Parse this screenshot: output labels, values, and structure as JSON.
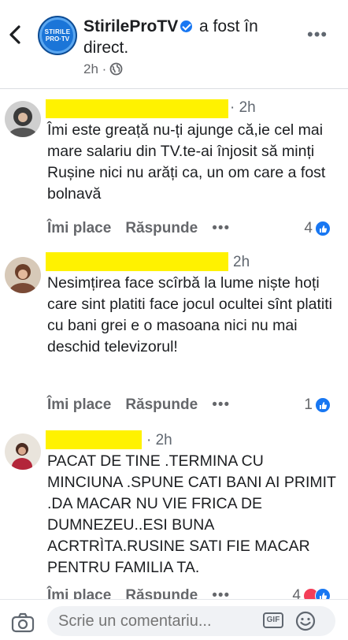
{
  "header": {
    "page_name": "StirileProTV",
    "action_text": "a fost în direct.",
    "time": "2h",
    "logo_line1": "STIRILE",
    "logo_line2": "PRO·TV"
  },
  "comments": [
    {
      "time": "· 2h",
      "text": "Îmi este greață nu-ți ajunge că,ie cel mai mare salariu din TV.te-ai înjosit să minți Rușine nici nu arăți ca, un om care a fost bolnavă",
      "like_label": "Îmi place",
      "reply_label": "Răspunde",
      "reactions": "4"
    },
    {
      "time": "2h",
      "text": "Nesimțirea face scîrbă la lume niște hoți care sint platiti face jocul ocultei sînt platiti cu bani grei e o masoana nici nu mai deschid televizorul!",
      "like_label": "Îmi place",
      "reply_label": "Răspunde",
      "reactions": "1"
    },
    {
      "time": "· 2h",
      "text": "PACAT DE TINE .TERMINA CU MINCIUNA .SPUNE CATI BANI AI PRIMIT .DA MACAR NU VIE FRICA DE DUMNEZEU..ESI BUNA ACRTRÌTA.RUSINE SATI FIE MACAR PENTRU FAMILIA TA.",
      "like_label": "Îmi place",
      "reply_label": "Răspunde",
      "reactions": "4"
    }
  ],
  "composer": {
    "placeholder": "Scrie un comentariu...",
    "gif_label": "GIF"
  },
  "icons": {
    "back": "chevron-left-icon",
    "globe": "globe-icon",
    "camera": "camera-icon",
    "smiley": "smiley-icon",
    "like": "like-icon"
  },
  "colors": {
    "accent": "#1877f2",
    "highlight": "#fff200",
    "secondary_text": "#65676b"
  }
}
